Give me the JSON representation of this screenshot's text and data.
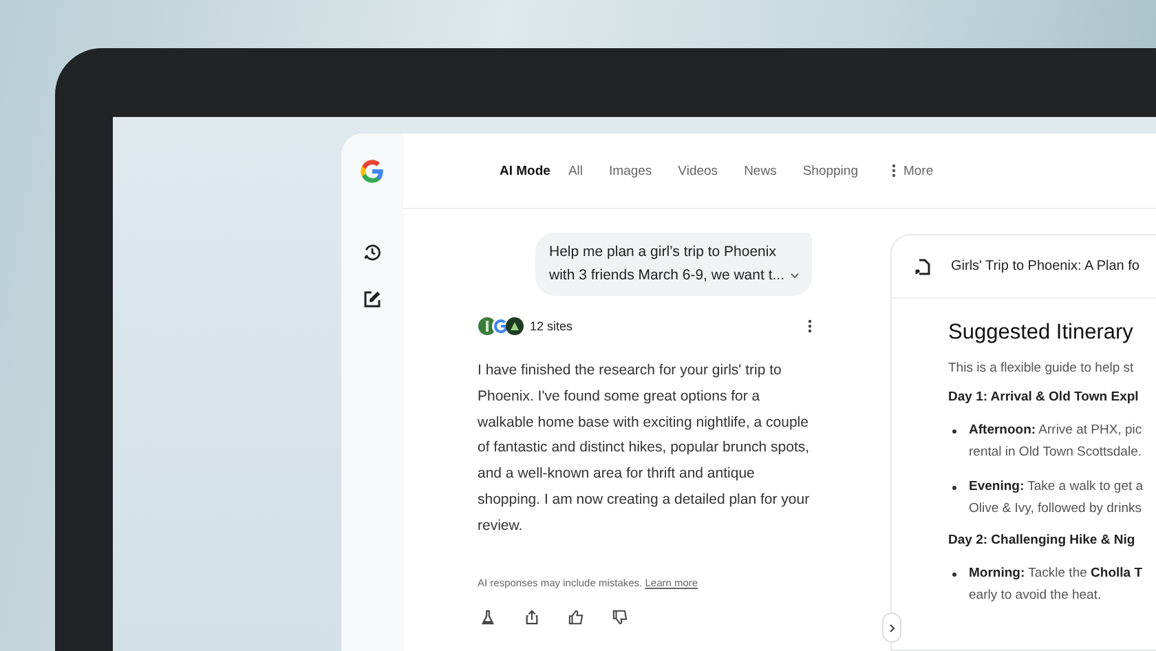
{
  "nav": {
    "tabs": [
      {
        "label": "AI Mode",
        "selected": true
      },
      {
        "label": "All",
        "selected": false
      },
      {
        "label": "Images",
        "selected": false
      },
      {
        "label": "Videos",
        "selected": false
      },
      {
        "label": "News",
        "selected": false
      },
      {
        "label": "Shopping",
        "selected": false
      }
    ],
    "more": "More"
  },
  "chat": {
    "query": "Help me plan a girl’s trip to Phoenix with 3 friends March 6-9, we want t...",
    "sources": "12 sites",
    "answer": "I have finished the research for your girls' trip to Phoenix. I've found some great options for a walkable home base with exciting nightlife, a couple of fantastic and distinct hikes, popular brunch spots, and a well-known area for thrift and antique shopping. I am now creating a detailed plan for your review.",
    "disclaimer": "AI responses may include mistakes.",
    "learn_more": "Learn more"
  },
  "document": {
    "title": "Girls' Trip to Phoenix: A Plan fo",
    "heading": "Suggested Itinerary",
    "blocks": [
      {
        "kind": "paragraph",
        "text": "This is a flexible guide to help st"
      },
      {
        "kind": "day",
        "text": "Day 1: Arrival & Old Town Expl"
      },
      {
        "kind": "bullet",
        "lines": [
          "**Afternoon:** Arrive at PHX, pic",
          "rental in Old Town Scottsdale."
        ]
      },
      {
        "kind": "bullet",
        "lines": [
          "**Evening:** Take a walk to get a",
          "Olive & Ivy, followed by drinks"
        ]
      },
      {
        "kind": "day",
        "text": "Day 2: Challenging Hike & Nig"
      },
      {
        "kind": "bullet",
        "lines": [
          "**Morning:** Tackle the **Cholla T**",
          "early to avoid the heat."
        ]
      }
    ]
  }
}
